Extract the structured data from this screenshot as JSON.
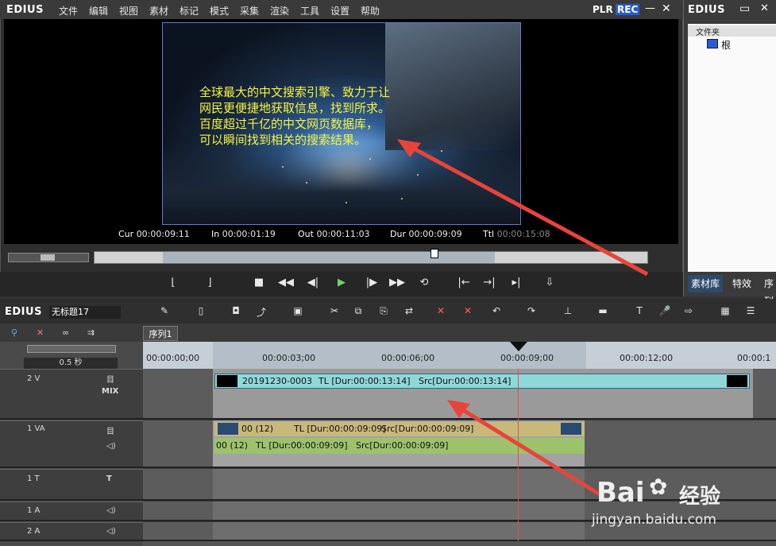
{
  "player": {
    "logo": "EDIUS",
    "menus": [
      "文件",
      "编辑",
      "视图",
      "素材",
      "标记",
      "模式",
      "采集",
      "渲染",
      "工具",
      "设置",
      "帮助"
    ],
    "mode_plr": "PLR",
    "mode_rec": "REC",
    "subtitle_lines": [
      "全球最大的中文搜索引擎、致力于让",
      "网民更便捷地获取信息，找到所求。",
      "百度超过千亿的中文网页数据库，",
      "可以瞬间找到相关的搜索结果。"
    ],
    "timecodes": [
      {
        "label": "Cur",
        "value": "00:00:09:11"
      },
      {
        "label": "In",
        "value": "00:00:01:19"
      },
      {
        "label": "Out",
        "value": "00:00:11:03"
      },
      {
        "label": "Dur",
        "value": "00:00:09:09"
      },
      {
        "label": "Ttl",
        "value": "00:00:15:08"
      }
    ]
  },
  "bin": {
    "logo": "EDIUS",
    "folder_header": "文件夹",
    "root_label": "根",
    "tabs": [
      "素材库",
      "特效",
      "序列"
    ]
  },
  "timeline": {
    "logo": "EDIUS",
    "project_name": "无标题17",
    "sequence_tab": "序列1",
    "zoom_label": "0.5 秒",
    "ruler_labels": [
      "00:00:00;00",
      "00:00:03;00",
      "00:00:06;00",
      "00:00:09;00",
      "00:00:12;00",
      "00:00:1"
    ],
    "tracks": {
      "v2": {
        "name": "2 V",
        "mix": "MIX",
        "clip_name": "20191230-0003",
        "clip_tl": "TL [Dur:00:00:13:14]",
        "clip_src": "Src[Dur:00:00:13:14]"
      },
      "va1": {
        "name": "1 VA",
        "video_name": "00 (12)",
        "video_tl": "TL [Dur:00:00:09:09]",
        "video_src": "Src[Dur:00:00:09:09]",
        "audio_name": "00 (12)",
        "audio_tl": "TL [Dur:00:00:09:09]",
        "audio_src": "Src[Dur:00:00:09:09]"
      },
      "t1": {
        "name": "1 T"
      },
      "a1": {
        "name": "1 A"
      },
      "a2": {
        "name": "2 A"
      }
    }
  },
  "watermark": {
    "brand": "Bai",
    "brand_tail": "经验",
    "url": "jingyan.baidu.com"
  },
  "colors": {
    "accent_arrow": "#e8443a",
    "subtitle": "#f6f63e",
    "v2_clip": "#8fd8d8",
    "va_video": "#c8b87a",
    "va_audio": "#9cc26c"
  }
}
